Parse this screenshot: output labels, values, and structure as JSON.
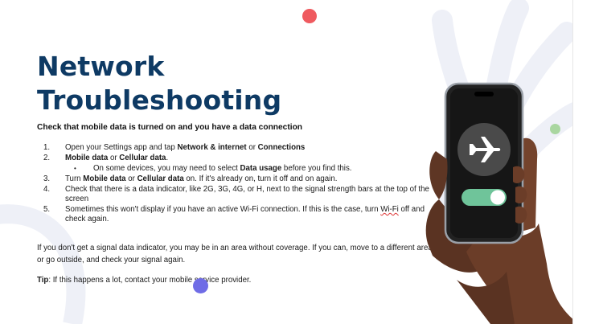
{
  "title": {
    "line1": "Network",
    "line2": "Troubleshooting"
  },
  "subtitle": "Check that mobile data is turned on and you have a data connection",
  "steps": [
    {
      "num": "1.",
      "parts": [
        "Open your Settings app and tap ",
        "Network & internet",
        " or ",
        "Connections"
      ]
    },
    {
      "num": "2.",
      "parts": [
        "Mobile data",
        " or ",
        "Cellular data",
        "."
      ]
    },
    {
      "num": "•",
      "parts": [
        "On some devices, you may need to select ",
        "Data usage",
        " before you find this."
      ]
    },
    {
      "num": "3.",
      "parts": [
        "Turn ",
        "Mobile data",
        " or ",
        "Cellular data",
        " on. If it's already on, turn it off and on again."
      ]
    },
    {
      "num": "4.",
      "text": "Check that there is a data indicator, like 2G, 3G, 4G, or H, next to the signal strength bars at the top of the screen"
    },
    {
      "num": "5.",
      "parts": [
        "Sometimes this won't display if you have an active Wi-Fi connection. If this is the case, turn ",
        "Wi-Fi",
        " off and check again."
      ]
    }
  ],
  "paragraph": "If you don't get a signal data indicator, you may be in an area without coverage. If you can, move to a different area, or go outside, and check your signal again.",
  "tip": {
    "label": "Tip",
    "text": ": If this happens a lot, contact your mobile service provider."
  },
  "phone": {
    "icon": "airplane-icon",
    "toggle_state": "on"
  },
  "colors": {
    "title": "#0e3a64",
    "accent_red": "#ef5a5f",
    "accent_green": "#a9d6a0",
    "accent_purple": "#6f6ce6",
    "toggle_on": "#6fc49a",
    "phone_screen": "#161616"
  }
}
